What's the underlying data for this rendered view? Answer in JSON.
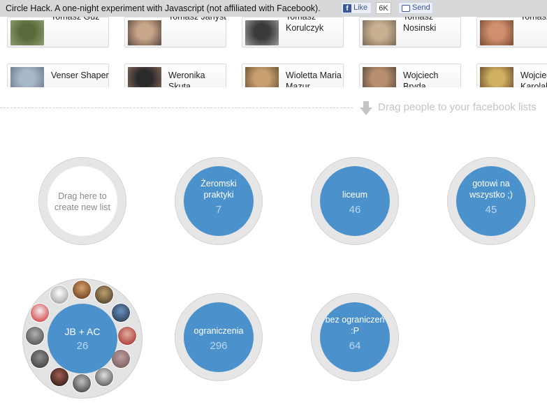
{
  "topbar": {
    "title": "Circle Hack. A one-night experiment with Javascript (not affiliated with Facebook).",
    "like_label": "Like",
    "like_count": "6K",
    "send_label": "Send"
  },
  "people_row1": [
    {
      "name": "Tomasz Guz",
      "colors": [
        "#5a6a3a",
        "#8fa070"
      ]
    },
    {
      "name": "Tomasz Janyst",
      "colors": [
        "#c9a58a",
        "#5b4a3f"
      ]
    },
    {
      "name": "Tomasz Korulczyk",
      "colors": [
        "#3a3a3a",
        "#9a9a9a"
      ]
    },
    {
      "name": "Tomasz Nosinski",
      "colors": [
        "#c8b090",
        "#7a6a5a"
      ]
    },
    {
      "name": "Tomasz",
      "colors": [
        "#d09070",
        "#7a4a30"
      ]
    }
  ],
  "people_row2": [
    {
      "name": "Venser Shaper",
      "colors": [
        "#a8b8c8",
        "#6a7888"
      ]
    },
    {
      "name": "Weronika Skuta",
      "colors": [
        "#2a2a2a",
        "#8a6a5a"
      ]
    },
    {
      "name": "Wioletta Maria Mazur",
      "colors": [
        "#c8a070",
        "#6a5030"
      ]
    },
    {
      "name": "Wojciech Bryda",
      "colors": [
        "#b89070",
        "#5a4a3a"
      ]
    },
    {
      "name": "Wojciech Karolak",
      "colors": [
        "#d0b060",
        "#6a4a2a"
      ]
    }
  ],
  "drag_hint": "Drag people to your facebook lists",
  "new_list": {
    "line1": "Drag here to",
    "line2": "create new list"
  },
  "lists": [
    {
      "name": "Żeromski praktyki",
      "line1": "Żeromski",
      "line2": "praktyki",
      "count": "7"
    },
    {
      "name": "liceum",
      "line1": "liceum",
      "line2": "",
      "count": "46"
    },
    {
      "name": "gotowi na wszystko ;)",
      "line1": "gotowi na",
      "line2": "wszystko ;)",
      "count": "45"
    },
    {
      "name": "JB + AC",
      "line1": "JB + AC",
      "line2": "",
      "count": "26"
    },
    {
      "name": "ograniczenia",
      "line1": "ograniczenia",
      "line2": "",
      "count": "296"
    },
    {
      "name": "bez ograniczeń :P",
      "line1": "bez ograniczeń",
      "line2": ":P",
      "count": "64"
    }
  ],
  "colors": {
    "accent": "#4b92cc",
    "ring": "#e6e6e6",
    "topbar": "#d8d8d8"
  }
}
